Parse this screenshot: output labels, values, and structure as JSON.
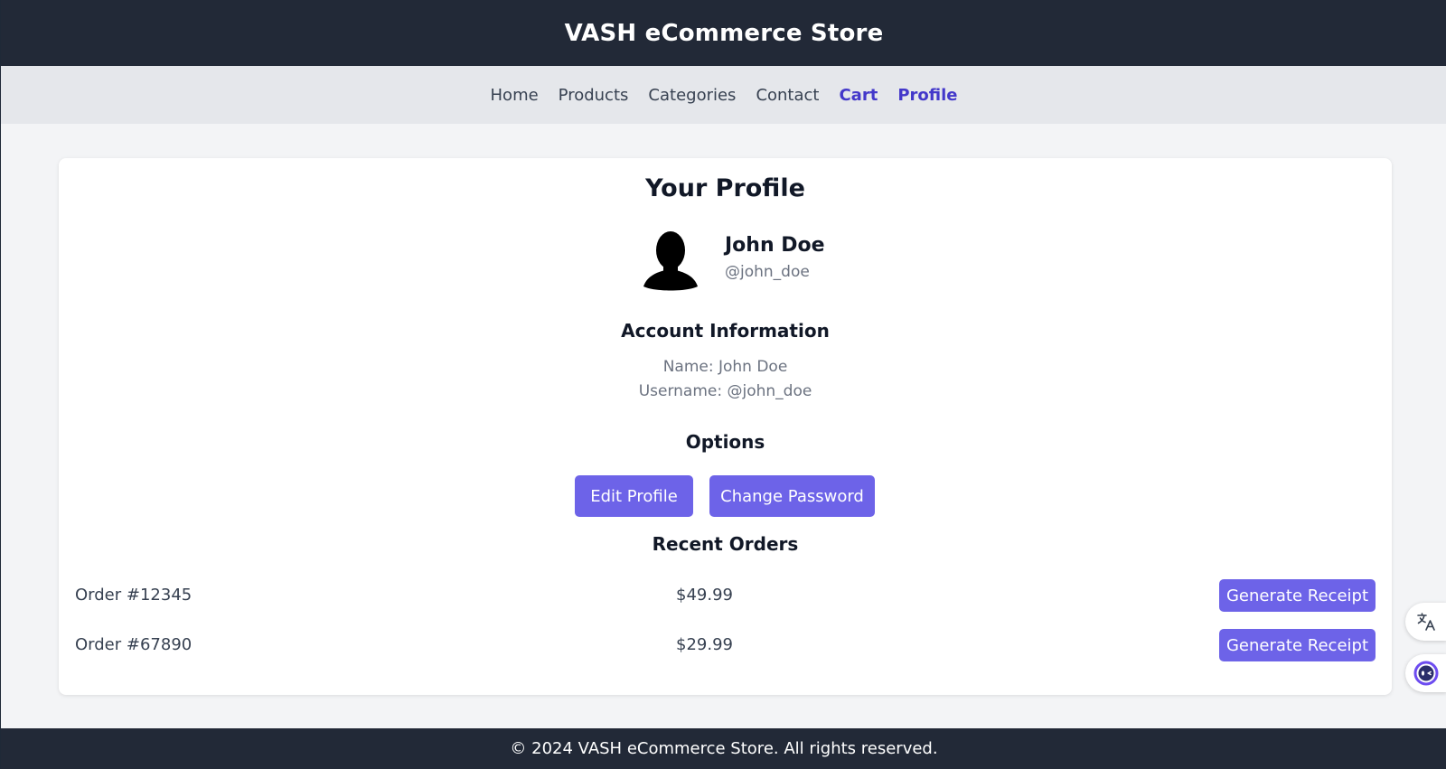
{
  "header": {
    "title": "VASH eCommerce Store"
  },
  "nav": {
    "items": [
      {
        "label": "Home"
      },
      {
        "label": "Products"
      },
      {
        "label": "Categories"
      },
      {
        "label": "Contact"
      },
      {
        "label": "Cart"
      },
      {
        "label": "Profile"
      }
    ]
  },
  "profile": {
    "title": "Your Profile",
    "avatar_icon": "person-silhouette-icon",
    "name": "John Doe",
    "handle": "@john_doe"
  },
  "account": {
    "title": "Account Information",
    "name_line": "Name: John Doe",
    "username_line": "Username: @john_doe"
  },
  "options": {
    "title": "Options",
    "edit_label": "Edit Profile",
    "password_label": "Change Password"
  },
  "orders": {
    "title": "Recent Orders",
    "rows": [
      {
        "id": "Order #12345",
        "price": "$49.99",
        "action": "Generate Receipt"
      },
      {
        "id": "Order #67890",
        "price": "$29.99",
        "action": "Generate Receipt"
      }
    ]
  },
  "footer": {
    "text": "© 2024 VASH eCommerce Store. All rights reserved."
  },
  "floating": {
    "translate_icon": "translate-icon",
    "assistant_icon": "assistant-icon"
  },
  "colors": {
    "dark_bar": "#222937",
    "nav_bg": "#e5e7eb",
    "page_bg": "#f3f4f6",
    "accent_button": "#6d63e8",
    "active_nav": "#4338ca"
  }
}
